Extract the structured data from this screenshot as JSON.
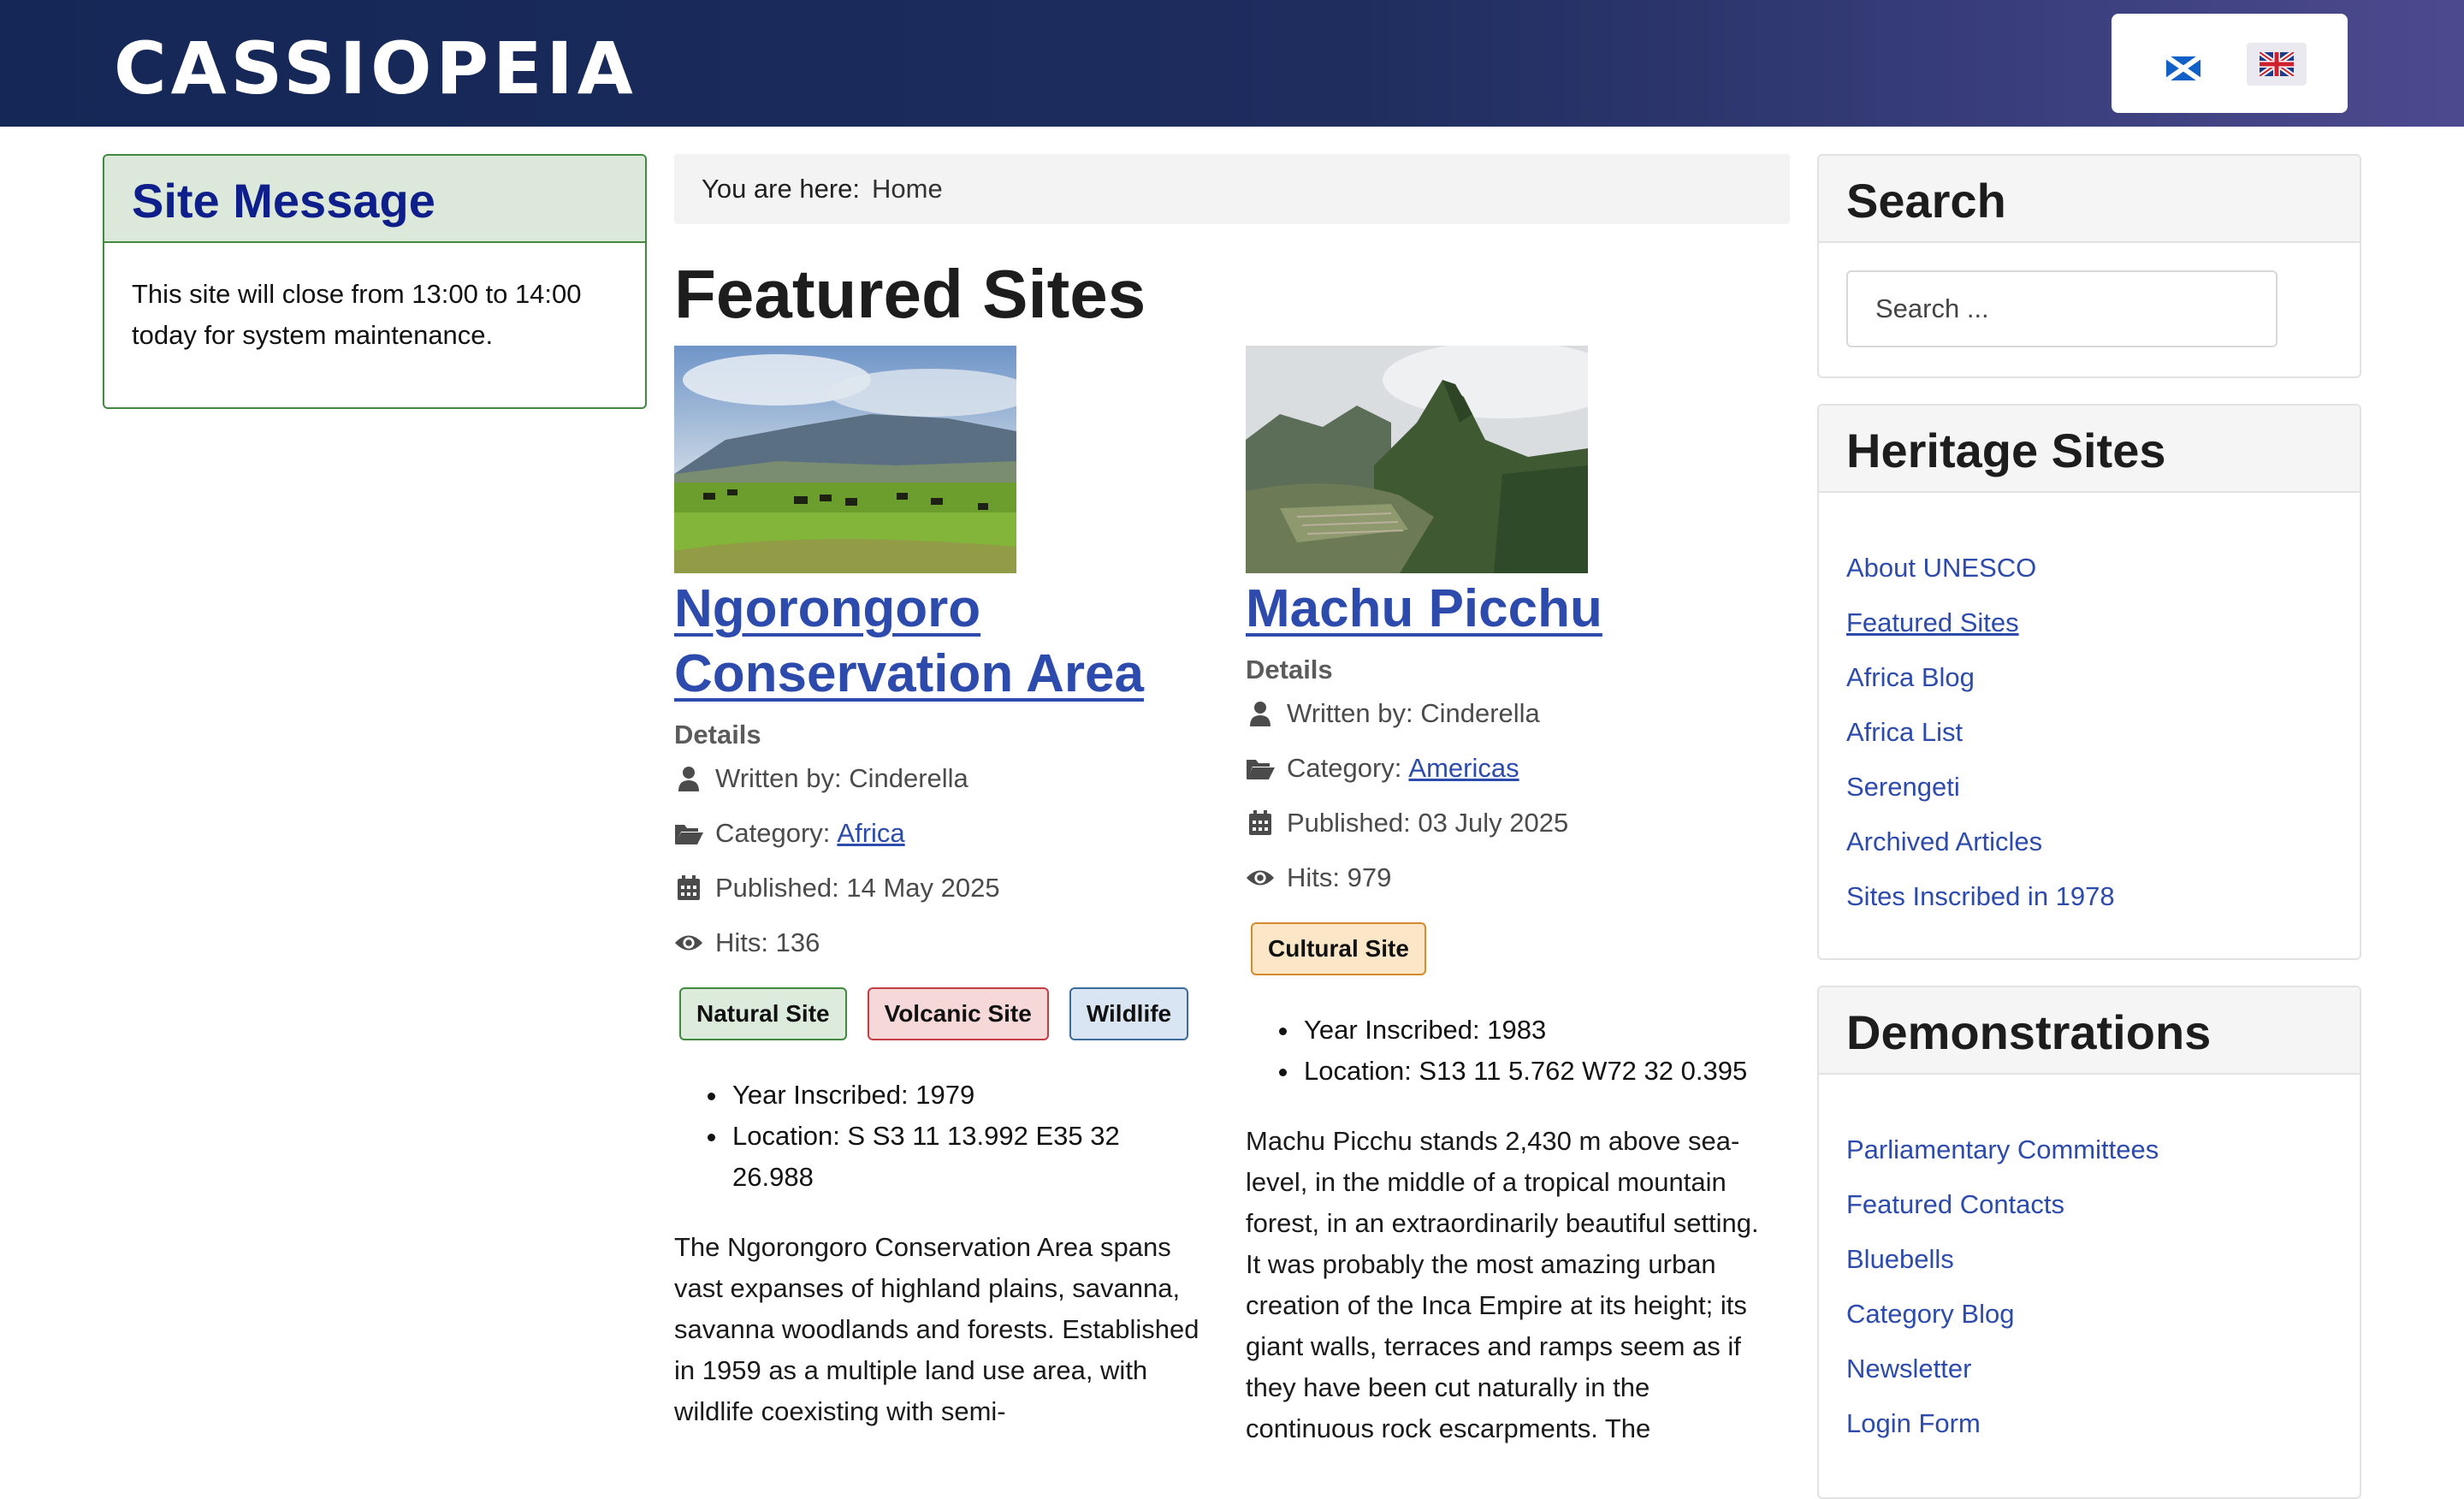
{
  "header": {
    "brand": "CASSIOPEIA",
    "languages": [
      {
        "name": "scotland-flag-icon"
      },
      {
        "name": "uk-flag-icon"
      }
    ]
  },
  "site_message": {
    "title": "Site Message",
    "text": "This site will close from 13:00 to 14:00 today for system maintenance."
  },
  "breadcrumb": {
    "label": "You are here:",
    "home": "Home"
  },
  "page_title": "Featured Sites",
  "articles": [
    {
      "title": "Ngorongoro Conservation Area",
      "details_label": "Details",
      "author": "Written by: Cinderella",
      "category_label": "Category:",
      "category": "Africa",
      "published": "Published: 14 May 2025",
      "hits": "Hits: 136",
      "tags": [
        "Natural Site",
        "Volcanic Site",
        "Wildlife"
      ],
      "facts": [
        "Year Inscribed: 1979",
        "Location: S S3 11 13.992 E35 32 26.988"
      ],
      "body": "The Ngorongoro Conservation Area spans vast expanses of highland plains, savanna, savanna woodlands and forests. Established in 1959 as a multiple land use area, with wildlife coexisting with semi-"
    },
    {
      "title": "Machu Picchu",
      "details_label": "Details",
      "author": "Written by: Cinderella",
      "category_label": "Category:",
      "category": "Americas",
      "published": "Published: 03 July 2025",
      "hits": "Hits: 979",
      "tags": [
        "Cultural Site"
      ],
      "facts": [
        "Year Inscribed: 1983",
        "Location: S13 11 5.762 W72 32 0.395"
      ],
      "body": "Machu Picchu stands 2,430 m above sea-level, in the middle of a tropical mountain forest, in an extraordinarily beautiful setting. It was probably the most amazing urban creation of the Inca Empire at its height; its giant walls, terraces and ramps seem as if they have been cut naturally in the continuous rock escarpments. The"
    }
  ],
  "search": {
    "title": "Search",
    "placeholder": "Search ..."
  },
  "heritage": {
    "title": "Heritage Sites",
    "items": [
      "About UNESCO",
      "Featured Sites",
      "Africa Blog",
      "Africa List",
      "Serengeti",
      "Archived Articles",
      "Sites Inscribed in 1978"
    ]
  },
  "demos": {
    "title": "Demonstrations",
    "items": [
      "Parliamentary Committees",
      "Featured Contacts",
      "Bluebells",
      "Category Blog",
      "Newsletter",
      "Login Form"
    ]
  },
  "colors": {
    "header_start": "#142756",
    "header_end": "#4c4a8f",
    "link": "#2d4bad",
    "message_title": "#0e1e8a"
  }
}
